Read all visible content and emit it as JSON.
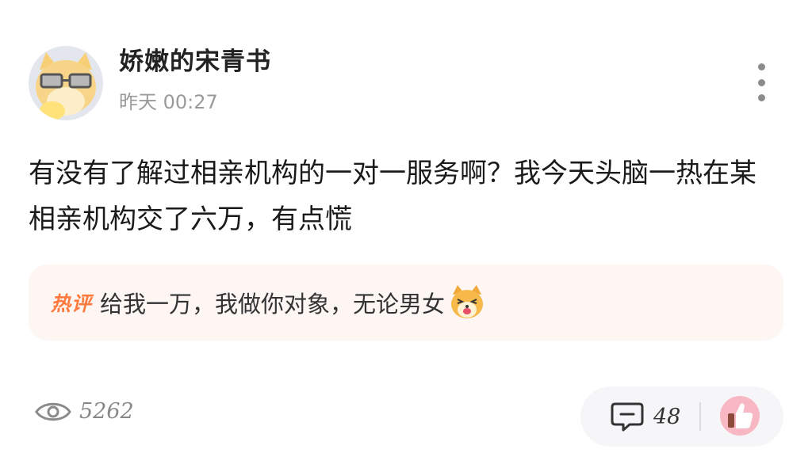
{
  "post": {
    "username": "娇嫩的宋青书",
    "timestamp": "昨天 00:27",
    "content": "有没有了解过相亲机构的一对一服务啊？我今天头脑一热在某相亲机构交了六万，有点慌"
  },
  "hot_comment": {
    "badge": "热评",
    "text": "给我一万，我做你对象，无论男女"
  },
  "stats": {
    "views": "5262",
    "comments": "48"
  },
  "icons": {
    "avatar": "cat-with-glasses-avatar",
    "more": "more-vertical-icon",
    "views": "eye-icon",
    "comments": "comment-bubble-icon",
    "like": "thumbs-up-icon",
    "emoji": "dog-laugh-emoji"
  },
  "colors": {
    "hot_badge": "#ff7a3c",
    "hot_background": "#fdf6f3",
    "muted_text": "#9a9a9a",
    "like_background": "#f7b8c4"
  }
}
